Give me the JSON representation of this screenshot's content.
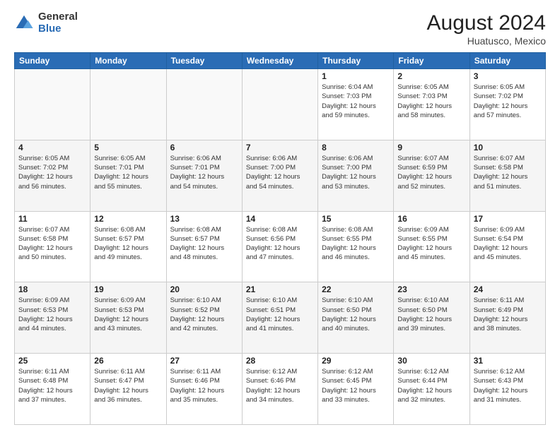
{
  "header": {
    "logo_general": "General",
    "logo_blue": "Blue",
    "month_year": "August 2024",
    "location": "Huatusco, Mexico"
  },
  "weekdays": [
    "Sunday",
    "Monday",
    "Tuesday",
    "Wednesday",
    "Thursday",
    "Friday",
    "Saturday"
  ],
  "weeks": [
    [
      {
        "day": "",
        "info": ""
      },
      {
        "day": "",
        "info": ""
      },
      {
        "day": "",
        "info": ""
      },
      {
        "day": "",
        "info": ""
      },
      {
        "day": "1",
        "info": "Sunrise: 6:04 AM\nSunset: 7:03 PM\nDaylight: 12 hours\nand 59 minutes."
      },
      {
        "day": "2",
        "info": "Sunrise: 6:05 AM\nSunset: 7:03 PM\nDaylight: 12 hours\nand 58 minutes."
      },
      {
        "day": "3",
        "info": "Sunrise: 6:05 AM\nSunset: 7:02 PM\nDaylight: 12 hours\nand 57 minutes."
      }
    ],
    [
      {
        "day": "4",
        "info": "Sunrise: 6:05 AM\nSunset: 7:02 PM\nDaylight: 12 hours\nand 56 minutes."
      },
      {
        "day": "5",
        "info": "Sunrise: 6:05 AM\nSunset: 7:01 PM\nDaylight: 12 hours\nand 55 minutes."
      },
      {
        "day": "6",
        "info": "Sunrise: 6:06 AM\nSunset: 7:01 PM\nDaylight: 12 hours\nand 54 minutes."
      },
      {
        "day": "7",
        "info": "Sunrise: 6:06 AM\nSunset: 7:00 PM\nDaylight: 12 hours\nand 54 minutes."
      },
      {
        "day": "8",
        "info": "Sunrise: 6:06 AM\nSunset: 7:00 PM\nDaylight: 12 hours\nand 53 minutes."
      },
      {
        "day": "9",
        "info": "Sunrise: 6:07 AM\nSunset: 6:59 PM\nDaylight: 12 hours\nand 52 minutes."
      },
      {
        "day": "10",
        "info": "Sunrise: 6:07 AM\nSunset: 6:58 PM\nDaylight: 12 hours\nand 51 minutes."
      }
    ],
    [
      {
        "day": "11",
        "info": "Sunrise: 6:07 AM\nSunset: 6:58 PM\nDaylight: 12 hours\nand 50 minutes."
      },
      {
        "day": "12",
        "info": "Sunrise: 6:08 AM\nSunset: 6:57 PM\nDaylight: 12 hours\nand 49 minutes."
      },
      {
        "day": "13",
        "info": "Sunrise: 6:08 AM\nSunset: 6:57 PM\nDaylight: 12 hours\nand 48 minutes."
      },
      {
        "day": "14",
        "info": "Sunrise: 6:08 AM\nSunset: 6:56 PM\nDaylight: 12 hours\nand 47 minutes."
      },
      {
        "day": "15",
        "info": "Sunrise: 6:08 AM\nSunset: 6:55 PM\nDaylight: 12 hours\nand 46 minutes."
      },
      {
        "day": "16",
        "info": "Sunrise: 6:09 AM\nSunset: 6:55 PM\nDaylight: 12 hours\nand 45 minutes."
      },
      {
        "day": "17",
        "info": "Sunrise: 6:09 AM\nSunset: 6:54 PM\nDaylight: 12 hours\nand 45 minutes."
      }
    ],
    [
      {
        "day": "18",
        "info": "Sunrise: 6:09 AM\nSunset: 6:53 PM\nDaylight: 12 hours\nand 44 minutes."
      },
      {
        "day": "19",
        "info": "Sunrise: 6:09 AM\nSunset: 6:53 PM\nDaylight: 12 hours\nand 43 minutes."
      },
      {
        "day": "20",
        "info": "Sunrise: 6:10 AM\nSunset: 6:52 PM\nDaylight: 12 hours\nand 42 minutes."
      },
      {
        "day": "21",
        "info": "Sunrise: 6:10 AM\nSunset: 6:51 PM\nDaylight: 12 hours\nand 41 minutes."
      },
      {
        "day": "22",
        "info": "Sunrise: 6:10 AM\nSunset: 6:50 PM\nDaylight: 12 hours\nand 40 minutes."
      },
      {
        "day": "23",
        "info": "Sunrise: 6:10 AM\nSunset: 6:50 PM\nDaylight: 12 hours\nand 39 minutes."
      },
      {
        "day": "24",
        "info": "Sunrise: 6:11 AM\nSunset: 6:49 PM\nDaylight: 12 hours\nand 38 minutes."
      }
    ],
    [
      {
        "day": "25",
        "info": "Sunrise: 6:11 AM\nSunset: 6:48 PM\nDaylight: 12 hours\nand 37 minutes."
      },
      {
        "day": "26",
        "info": "Sunrise: 6:11 AM\nSunset: 6:47 PM\nDaylight: 12 hours\nand 36 minutes."
      },
      {
        "day": "27",
        "info": "Sunrise: 6:11 AM\nSunset: 6:46 PM\nDaylight: 12 hours\nand 35 minutes."
      },
      {
        "day": "28",
        "info": "Sunrise: 6:12 AM\nSunset: 6:46 PM\nDaylight: 12 hours\nand 34 minutes."
      },
      {
        "day": "29",
        "info": "Sunrise: 6:12 AM\nSunset: 6:45 PM\nDaylight: 12 hours\nand 33 minutes."
      },
      {
        "day": "30",
        "info": "Sunrise: 6:12 AM\nSunset: 6:44 PM\nDaylight: 12 hours\nand 32 minutes."
      },
      {
        "day": "31",
        "info": "Sunrise: 6:12 AM\nSunset: 6:43 PM\nDaylight: 12 hours\nand 31 minutes."
      }
    ]
  ]
}
